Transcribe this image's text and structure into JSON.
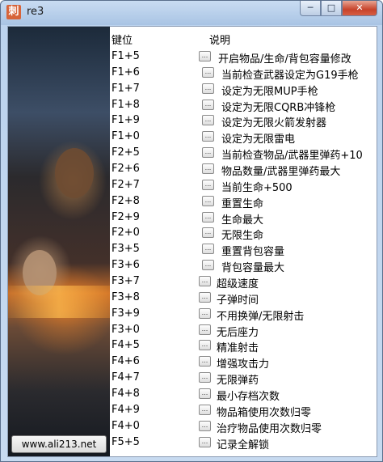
{
  "window": {
    "title": "re3",
    "app_icon_glyph": "刺",
    "minimize_glyph": "─",
    "maximize_glyph": "□",
    "close_glyph": "✕"
  },
  "panel": {
    "site_button_label": "www.ali213.net"
  },
  "table": {
    "key_header": "键位",
    "desc_header": "说明",
    "button_glyph": "...",
    "rows": [
      {
        "key": "F1+5",
        "desc": "开启物品/生命/背包容量修改"
      },
      {
        "key": "F1+6",
        "desc": "当前检查武器设定为G19手枪"
      },
      {
        "key": "F1+7",
        "desc": "设定为无限MUP手枪"
      },
      {
        "key": "F1+8",
        "desc": "设定为无限CQRB冲锋枪"
      },
      {
        "key": "F1+9",
        "desc": "设定为无限火箭发射器"
      },
      {
        "key": "F1+0",
        "desc": "设定为无限雷电"
      },
      {
        "key": "F2+5",
        "desc": "当前检查物品/武器里弹药+10"
      },
      {
        "key": "F2+6",
        "desc": "物品数量/武器里弹药最大"
      },
      {
        "key": "F2+7",
        "desc": "当前生命+500"
      },
      {
        "key": "F2+8",
        "desc": "重置生命"
      },
      {
        "key": "F2+9",
        "desc": "生命最大"
      },
      {
        "key": "F2+0",
        "desc": "无限生命"
      },
      {
        "key": "F3+5",
        "desc": "重置背包容量"
      },
      {
        "key": "F3+6",
        "desc": "背包容量最大"
      },
      {
        "key": "F3+7",
        "desc": "超级速度"
      },
      {
        "key": "F3+8",
        "desc": "子弹时间"
      },
      {
        "key": "F3+9",
        "desc": "不用换弹/无限射击"
      },
      {
        "key": "F3+0",
        "desc": "无后座力"
      },
      {
        "key": "F4+5",
        "desc": "精准射击"
      },
      {
        "key": "F4+6",
        "desc": "增强攻击力"
      },
      {
        "key": "F4+7",
        "desc": "无限弹药"
      },
      {
        "key": "F4+8",
        "desc": "最小存档次数"
      },
      {
        "key": "F4+9",
        "desc": "物品箱使用次数归零"
      },
      {
        "key": "F4+0",
        "desc": "治疗物品使用次数归零"
      },
      {
        "key": "F5+5",
        "desc": "记录全解锁"
      }
    ]
  }
}
